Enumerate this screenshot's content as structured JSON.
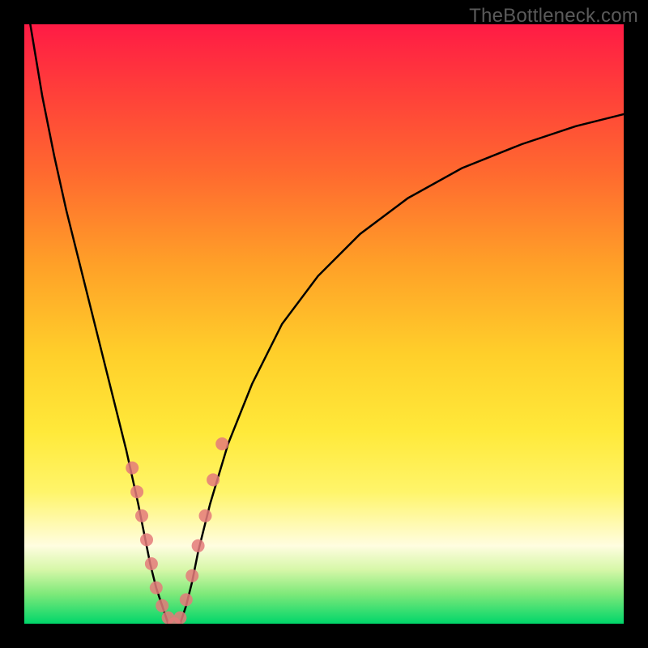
{
  "watermark": {
    "text": "TheBottleneck.com"
  },
  "chart_data": {
    "type": "line",
    "title": "",
    "xlabel": "",
    "ylabel": "",
    "xlim": [
      0,
      100
    ],
    "ylim": [
      0,
      100
    ],
    "grid": false,
    "legend": false,
    "background_gradient_stops": [
      {
        "pos": 0,
        "color": "#ff1b45"
      },
      {
        "pos": 10,
        "color": "#ff3b3b"
      },
      {
        "pos": 25,
        "color": "#ff6a2f"
      },
      {
        "pos": 40,
        "color": "#ffa028"
      },
      {
        "pos": 55,
        "color": "#ffcf2a"
      },
      {
        "pos": 68,
        "color": "#ffe93a"
      },
      {
        "pos": 78,
        "color": "#fff56a"
      },
      {
        "pos": 87,
        "color": "#fffde0"
      },
      {
        "pos": 91,
        "color": "#d6f7a8"
      },
      {
        "pos": 95,
        "color": "#7fe97a"
      },
      {
        "pos": 100,
        "color": "#00d66a"
      }
    ],
    "series": [
      {
        "name": "left-branch",
        "color": "#000000",
        "x": [
          1,
          3,
          5,
          7,
          9,
          11,
          13,
          15,
          17,
          19,
          20,
          21,
          22,
          23,
          24
        ],
        "y": [
          100,
          88,
          78,
          69,
          61,
          53,
          45,
          37,
          29,
          20,
          15,
          10,
          6,
          3,
          0
        ]
      },
      {
        "name": "right-branch",
        "color": "#000000",
        "x": [
          26,
          27,
          28,
          29,
          31,
          34,
          38,
          43,
          49,
          56,
          64,
          73,
          83,
          92,
          100
        ],
        "y": [
          0,
          3,
          7,
          12,
          20,
          30,
          40,
          50,
          58,
          65,
          71,
          76,
          80,
          83,
          85
        ]
      }
    ],
    "scatter_overlay": {
      "name": "markers",
      "color": "#e47a7a",
      "points": [
        {
          "x": 18.0,
          "y": 26
        },
        {
          "x": 18.8,
          "y": 22
        },
        {
          "x": 19.6,
          "y": 18
        },
        {
          "x": 20.4,
          "y": 14
        },
        {
          "x": 21.2,
          "y": 10
        },
        {
          "x": 22.0,
          "y": 6
        },
        {
          "x": 23.0,
          "y": 3
        },
        {
          "x": 24.0,
          "y": 1
        },
        {
          "x": 25.0,
          "y": 0
        },
        {
          "x": 26.0,
          "y": 1
        },
        {
          "x": 27.0,
          "y": 4
        },
        {
          "x": 28.0,
          "y": 8
        },
        {
          "x": 29.0,
          "y": 13
        },
        {
          "x": 30.2,
          "y": 18
        },
        {
          "x": 31.5,
          "y": 24
        },
        {
          "x": 33.0,
          "y": 30
        }
      ]
    }
  }
}
